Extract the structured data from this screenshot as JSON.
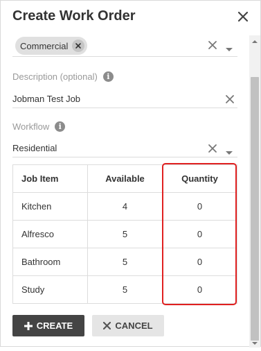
{
  "dialog": {
    "title": "Create Work Order"
  },
  "fields": {
    "client_type": {
      "chip_label": "Commercial"
    },
    "description": {
      "label": "Description (optional)",
      "value": "Jobman Test Job"
    },
    "workflow": {
      "label": "Workflow",
      "value": "Residential"
    }
  },
  "table": {
    "headers": [
      "Job Item",
      "Available",
      "Quantity"
    ],
    "rows": [
      {
        "item": "Kitchen",
        "available": "4",
        "quantity": "0"
      },
      {
        "item": "Alfresco",
        "available": "5",
        "quantity": "0"
      },
      {
        "item": "Bathroom",
        "available": "5",
        "quantity": "0"
      },
      {
        "item": "Study",
        "available": "5",
        "quantity": "0"
      }
    ]
  },
  "buttons": {
    "create": "CREATE",
    "cancel": "CANCEL"
  },
  "icons": {
    "close": "close-icon",
    "info": "info-icon",
    "clear": "clear-icon",
    "dropdown": "dropdown-arrow-icon"
  },
  "colors": {
    "primary_button": "#444444",
    "secondary_button": "#e5e5e5",
    "highlight": "#e02020"
  }
}
